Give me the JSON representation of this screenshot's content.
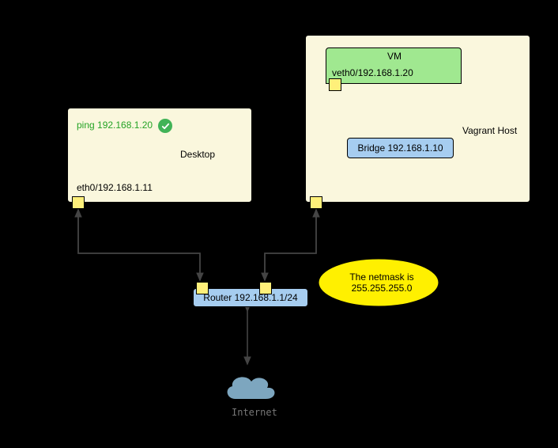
{
  "desktop": {
    "label": "Desktop",
    "ping": "ping 192.168.1.20",
    "port": "eth0/192.168.1.11"
  },
  "host": {
    "label": "Vagrant Host"
  },
  "vm": {
    "label": "VM",
    "port": "veth0/192.168.1.20"
  },
  "bridge": {
    "label": "Bridge 192.168.1.10"
  },
  "router": {
    "label": "Router 192.168.1.1/24"
  },
  "note": {
    "line1": "The netmask  is",
    "line2": "255.255.255.0"
  },
  "cloud": {
    "label": "Internet"
  },
  "chart_data": {
    "type": "network-diagram",
    "nodes": [
      {
        "id": "desktop",
        "label": "Desktop",
        "interfaces": [
          {
            "name": "eth0",
            "ip": "192.168.1.11"
          }
        ],
        "action": "ping 192.168.1.20",
        "action_status": "success"
      },
      {
        "id": "vagrant-host",
        "label": "Vagrant Host",
        "contains": [
          "vm",
          "bridge"
        ]
      },
      {
        "id": "vm",
        "label": "VM",
        "interfaces": [
          {
            "name": "veth0",
            "ip": "192.168.1.20"
          }
        ]
      },
      {
        "id": "bridge",
        "label": "Bridge",
        "ip": "192.168.1.10"
      },
      {
        "id": "router",
        "label": "Router",
        "ip": "192.168.1.1",
        "cidr": 24,
        "netmask": "255.255.255.0"
      },
      {
        "id": "internet",
        "label": "Internet"
      }
    ],
    "edges": [
      {
        "from": "desktop",
        "to": "router",
        "bidirectional": true
      },
      {
        "from": "vagrant-host",
        "to": "router",
        "bidirectional": true
      },
      {
        "from": "vagrant-host",
        "to": "bridge",
        "bidirectional": true
      },
      {
        "from": "bridge",
        "to": "vm",
        "bidirectional": true
      },
      {
        "from": "router",
        "to": "internet",
        "bidirectional": true
      }
    ],
    "annotation": "The netmask is 255.255.255.0"
  }
}
